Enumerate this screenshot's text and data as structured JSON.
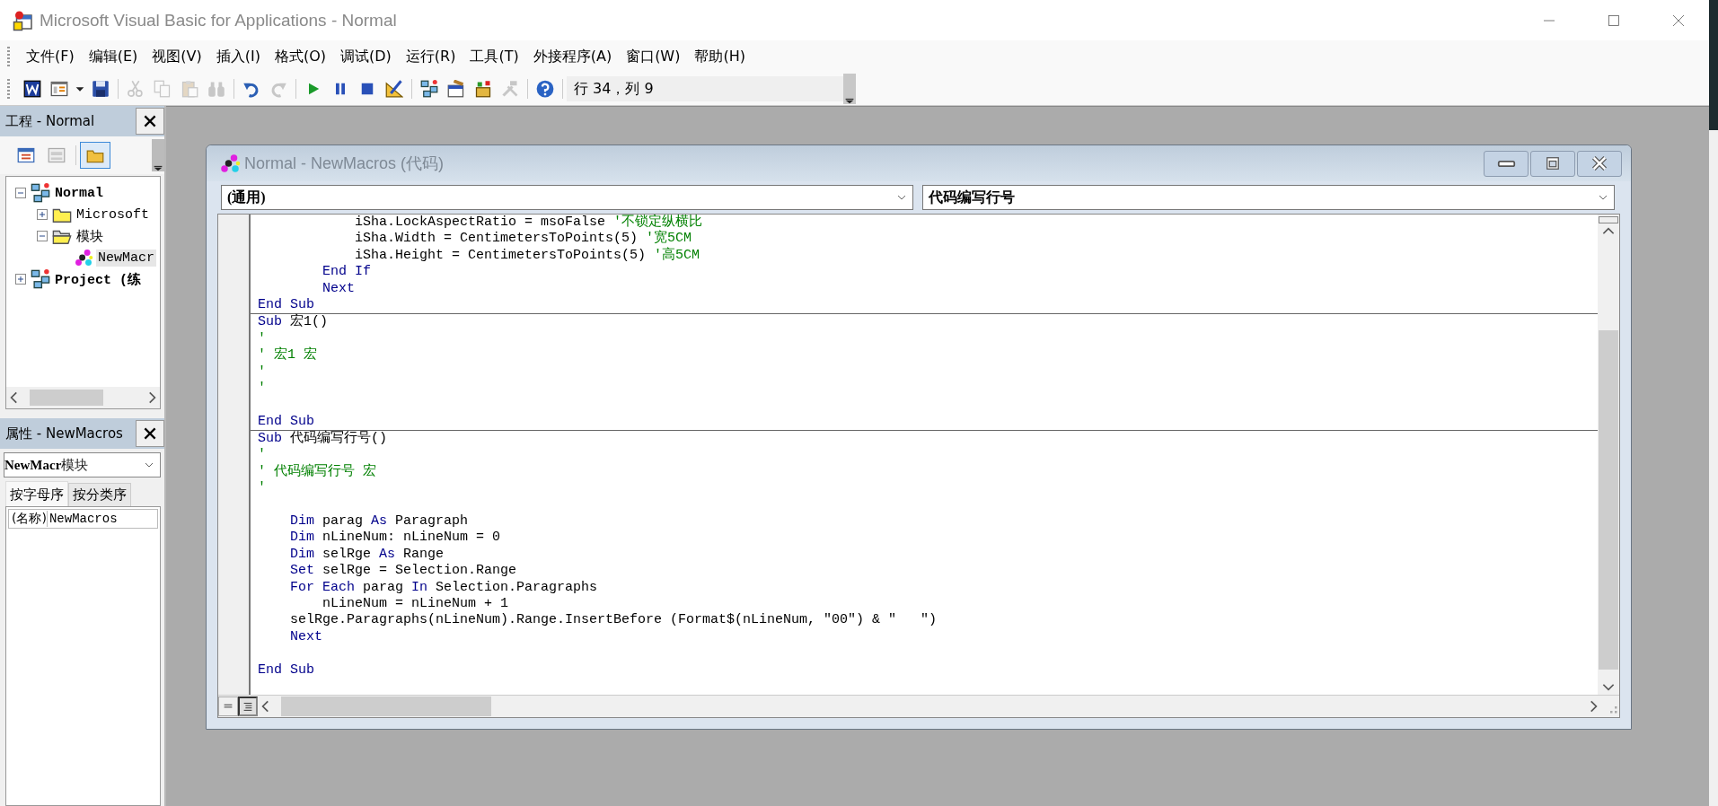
{
  "window": {
    "title": "Microsoft Visual Basic for Applications - Normal"
  },
  "menu": [
    "文件(F)",
    "编辑(E)",
    "视图(V)",
    "插入(I)",
    "格式(O)",
    "调试(D)",
    "运行(R)",
    "工具(T)",
    "外接程序(A)",
    "窗口(W)",
    "帮助(H)"
  ],
  "toolbar": [
    {
      "kind": "word",
      "disabled": false
    },
    {
      "kind": "view",
      "disabled": false
    },
    {
      "kind": "caret",
      "disabled": false
    },
    {
      "kind": "save",
      "disabled": false
    },
    {
      "kind": "separator"
    },
    {
      "kind": "cut",
      "disabled": true
    },
    {
      "kind": "copy",
      "disabled": true
    },
    {
      "kind": "paste",
      "disabled": true
    },
    {
      "kind": "find",
      "disabled": true
    },
    {
      "kind": "separator"
    },
    {
      "kind": "undo",
      "disabled": false
    },
    {
      "kind": "redo",
      "disabled": true
    },
    {
      "kind": "separator"
    },
    {
      "kind": "run",
      "disabled": false
    },
    {
      "kind": "pause",
      "disabled": false
    },
    {
      "kind": "stop",
      "disabled": false
    },
    {
      "kind": "design",
      "disabled": false
    },
    {
      "kind": "separator"
    },
    {
      "kind": "project",
      "disabled": false
    },
    {
      "kind": "properties",
      "disabled": false
    },
    {
      "kind": "browser",
      "disabled": false
    },
    {
      "kind": "toolbox",
      "disabled": true
    },
    {
      "kind": "separator"
    },
    {
      "kind": "help",
      "disabled": false
    }
  ],
  "cursor_position": "行 34，列 9",
  "project_explorer": {
    "title": "工程 - Normal",
    "buttons": [
      {
        "kind": "code",
        "selected": false
      },
      {
        "kind": "object",
        "selected": false
      },
      {
        "kind": "folders",
        "selected": true
      }
    ],
    "tree": [
      {
        "label": "Normal",
        "kind": "project",
        "expanded": true,
        "selected": false,
        "children": [
          {
            "label": "Microsoft",
            "kind": "folder",
            "expanded": false,
            "selected": false
          },
          {
            "label": "模块",
            "kind": "folder-open",
            "expanded": true,
            "selected": false,
            "children": [
              {
                "label": "NewMacr",
                "kind": "module",
                "selected": true
              }
            ]
          }
        ]
      },
      {
        "label": "Project (练",
        "kind": "project",
        "expanded": false,
        "selected": false
      }
    ]
  },
  "properties": {
    "title": "属性 - NewMacros",
    "object": {
      "name": "NewMacr",
      "type": "模块"
    },
    "tabs": [
      {
        "label": "按字母序",
        "selected": true
      },
      {
        "label": "按分类序",
        "selected": false
      }
    ],
    "rows": [
      {
        "name": "(名称)",
        "value": "NewMacros"
      }
    ]
  },
  "code_window": {
    "title": "Normal - NewMacros (代码)",
    "object_combo": "(通用)",
    "procedure_combo": "代码编写行号",
    "view_buttons": [
      {
        "kind": "procedure",
        "selected": false
      },
      {
        "kind": "module",
        "selected": true
      }
    ],
    "procedures": [
      {
        "lines": [
          {
            "kind": "code",
            "segments": [
              {
                "kind": "plain",
                "text": "            iSha.LockAspectRatio = msoFalse "
              },
              {
                "kind": "comment",
                "text": "'不锁定纵横比"
              }
            ]
          },
          {
            "kind": "code",
            "segments": [
              {
                "kind": "plain",
                "text": "            iSha.Width = CentimetersToPoints(5) "
              },
              {
                "kind": "comment",
                "text": "'宽5CM"
              }
            ]
          },
          {
            "kind": "code",
            "segments": [
              {
                "kind": "plain",
                "text": "            iSha.Height = CentimetersToPoints(5) "
              },
              {
                "kind": "comment",
                "text": "'高5CM"
              }
            ]
          },
          {
            "kind": "code",
            "segments": [
              {
                "kind": "keyword",
                "text": "        End If"
              }
            ]
          },
          {
            "kind": "code",
            "segments": [
              {
                "kind": "keyword",
                "text": "        Next"
              }
            ]
          },
          {
            "kind": "code",
            "segments": [
              {
                "kind": "keyword",
                "text": "End Sub"
              }
            ]
          }
        ]
      },
      {
        "lines": [
          {
            "kind": "code",
            "segments": [
              {
                "kind": "keyword",
                "text": "Sub"
              },
              {
                "kind": "plain",
                "text": " 宏1()"
              }
            ]
          },
          {
            "kind": "code",
            "segments": [
              {
                "kind": "comment",
                "text": "'"
              }
            ]
          },
          {
            "kind": "code",
            "segments": [
              {
                "kind": "comment",
                "text": "' 宏1 宏"
              }
            ]
          },
          {
            "kind": "code",
            "segments": [
              {
                "kind": "comment",
                "text": "'"
              }
            ]
          },
          {
            "kind": "code",
            "segments": [
              {
                "kind": "comment",
                "text": "'"
              }
            ]
          },
          {
            "kind": "blank"
          },
          {
            "kind": "code",
            "segments": [
              {
                "kind": "keyword",
                "text": "End Sub"
              }
            ]
          }
        ]
      },
      {
        "lines": [
          {
            "kind": "code",
            "segments": [
              {
                "kind": "keyword",
                "text": "Sub"
              },
              {
                "kind": "plain",
                "text": " 代码编写行号()"
              }
            ]
          },
          {
            "kind": "code",
            "segments": [
              {
                "kind": "comment",
                "text": "'"
              }
            ]
          },
          {
            "kind": "code",
            "segments": [
              {
                "kind": "comment",
                "text": "' 代码编写行号 宏"
              }
            ]
          },
          {
            "kind": "code",
            "segments": [
              {
                "kind": "comment",
                "text": "'"
              }
            ]
          },
          {
            "kind": "blank"
          },
          {
            "kind": "code",
            "segments": [
              {
                "kind": "keyword",
                "text": "    Dim"
              },
              {
                "kind": "plain",
                "text": " parag "
              },
              {
                "kind": "keyword",
                "text": "As"
              },
              {
                "kind": "plain",
                "text": " Paragraph"
              }
            ]
          },
          {
            "kind": "code",
            "segments": [
              {
                "kind": "keyword",
                "text": "    Dim"
              },
              {
                "kind": "plain",
                "text": " nLineNum: nLineNum = 0"
              }
            ]
          },
          {
            "kind": "code",
            "segments": [
              {
                "kind": "keyword",
                "text": "    Dim"
              },
              {
                "kind": "plain",
                "text": " selRge "
              },
              {
                "kind": "keyword",
                "text": "As"
              },
              {
                "kind": "plain",
                "text": " Range"
              }
            ]
          },
          {
            "kind": "code",
            "segments": [
              {
                "kind": "keyword",
                "text": "    Set"
              },
              {
                "kind": "plain",
                "text": " selRge = Selection.Range"
              }
            ]
          },
          {
            "kind": "code",
            "segments": [
              {
                "kind": "keyword",
                "text": "    For Each"
              },
              {
                "kind": "plain",
                "text": " parag "
              },
              {
                "kind": "keyword",
                "text": "In"
              },
              {
                "kind": "plain",
                "text": " Selection.Paragraphs"
              }
            ]
          },
          {
            "kind": "code",
            "segments": [
              {
                "kind": "plain",
                "text": "        nLineNum = nLineNum + 1"
              }
            ]
          },
          {
            "kind": "code",
            "segments": [
              {
                "kind": "plain",
                "text": "    selRge.Paragraphs(nLineNum).Range.InsertBefore (Format$(nLineNum, \"00\") & \"   \")"
              }
            ]
          },
          {
            "kind": "code",
            "segments": [
              {
                "kind": "keyword",
                "text": "    Next"
              }
            ]
          },
          {
            "kind": "blank"
          },
          {
            "kind": "code",
            "segments": [
              {
                "kind": "keyword",
                "text": "End Sub"
              }
            ]
          }
        ]
      }
    ]
  }
}
